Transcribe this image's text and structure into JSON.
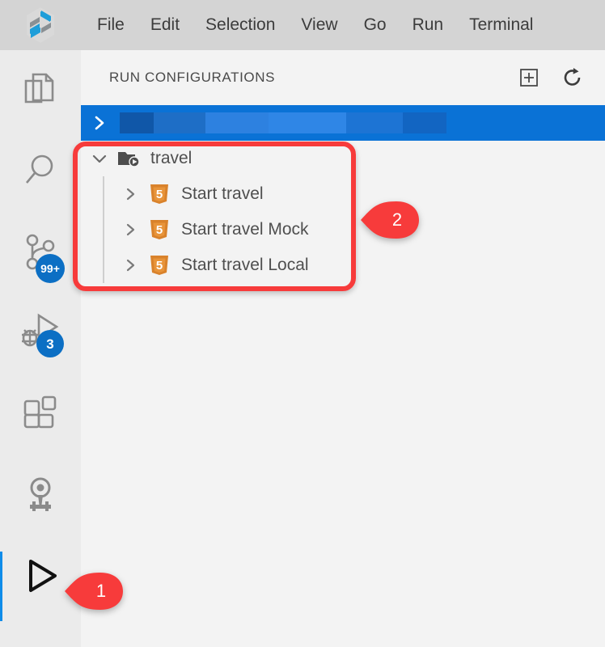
{
  "app": {
    "logo_icon": "theia-logo-icon",
    "brand_blue": "#1f9ed9",
    "brand_gray": "#8a9094"
  },
  "menubar": {
    "background": "#d4d4d4",
    "items": [
      {
        "label": "File",
        "name": "menu-file"
      },
      {
        "label": "Edit",
        "name": "menu-edit"
      },
      {
        "label": "Selection",
        "name": "menu-selection"
      },
      {
        "label": "View",
        "name": "menu-view"
      },
      {
        "label": "Go",
        "name": "menu-go"
      },
      {
        "label": "Run",
        "name": "menu-run"
      },
      {
        "label": "Terminal",
        "name": "menu-terminal"
      }
    ]
  },
  "activitybar": {
    "background": "#ebebeb",
    "active_indicator_color": "#0f8ce9",
    "badge_color": "#0c6fc4",
    "items": [
      {
        "name": "activity-explorer",
        "icon": "files-icon",
        "badge": null,
        "active": false
      },
      {
        "name": "activity-search",
        "icon": "search-icon",
        "badge": null,
        "active": false
      },
      {
        "name": "activity-source-control",
        "icon": "source-control-icon",
        "badge": "99+",
        "active": false
      },
      {
        "name": "activity-debug",
        "icon": "debug-icon",
        "badge": "3",
        "active": false
      },
      {
        "name": "activity-extensions",
        "icon": "extensions-icon",
        "badge": null,
        "active": false
      },
      {
        "name": "activity-plugins",
        "icon": "lightbulb-gear-icon",
        "badge": null,
        "active": false
      },
      {
        "name": "activity-run-configurations",
        "icon": "play-triangle-icon",
        "badge": null,
        "active": true
      }
    ]
  },
  "panel": {
    "title": "RUN CONFIGURATIONS",
    "background": "#f3f3f3",
    "actions": [
      {
        "name": "add-configuration-button",
        "icon": "plus-in-square-icon",
        "tooltip": "Add"
      },
      {
        "name": "refresh-configurations-button",
        "icon": "refresh-icon",
        "tooltip": "Refresh"
      }
    ]
  },
  "tree": {
    "selected_row": {
      "name": "tree-row-selected-redacted",
      "twisty": "chevron-right-icon",
      "label": "",
      "background": "#0a72d6",
      "redacted": true
    },
    "folder": {
      "name": "tree-row-folder-travel",
      "twisty": "chevron-down-icon",
      "icon": "folder-run-icon",
      "label": "travel",
      "expanded": true
    },
    "configs": [
      {
        "name": "tree-row-start-travel",
        "twisty": "chevron-right-icon",
        "icon": "html5-icon",
        "label": "Start travel"
      },
      {
        "name": "tree-row-start-travel-mock",
        "twisty": "chevron-right-icon",
        "icon": "html5-icon",
        "label": "Start travel Mock"
      },
      {
        "name": "tree-row-start-travel-local",
        "twisty": "chevron-right-icon",
        "icon": "html5-icon",
        "label": "Start travel Local"
      }
    ]
  },
  "annotations": {
    "color": "#f73b3b",
    "pins": [
      {
        "name": "annotation-pin-1",
        "label": "1",
        "target": "activity-run-configurations"
      },
      {
        "name": "annotation-pin-2",
        "label": "2",
        "target": "run-configurations-tree"
      }
    ],
    "boxes": [
      {
        "name": "annotation-box-tree",
        "target": "run-configurations-tree"
      }
    ]
  }
}
